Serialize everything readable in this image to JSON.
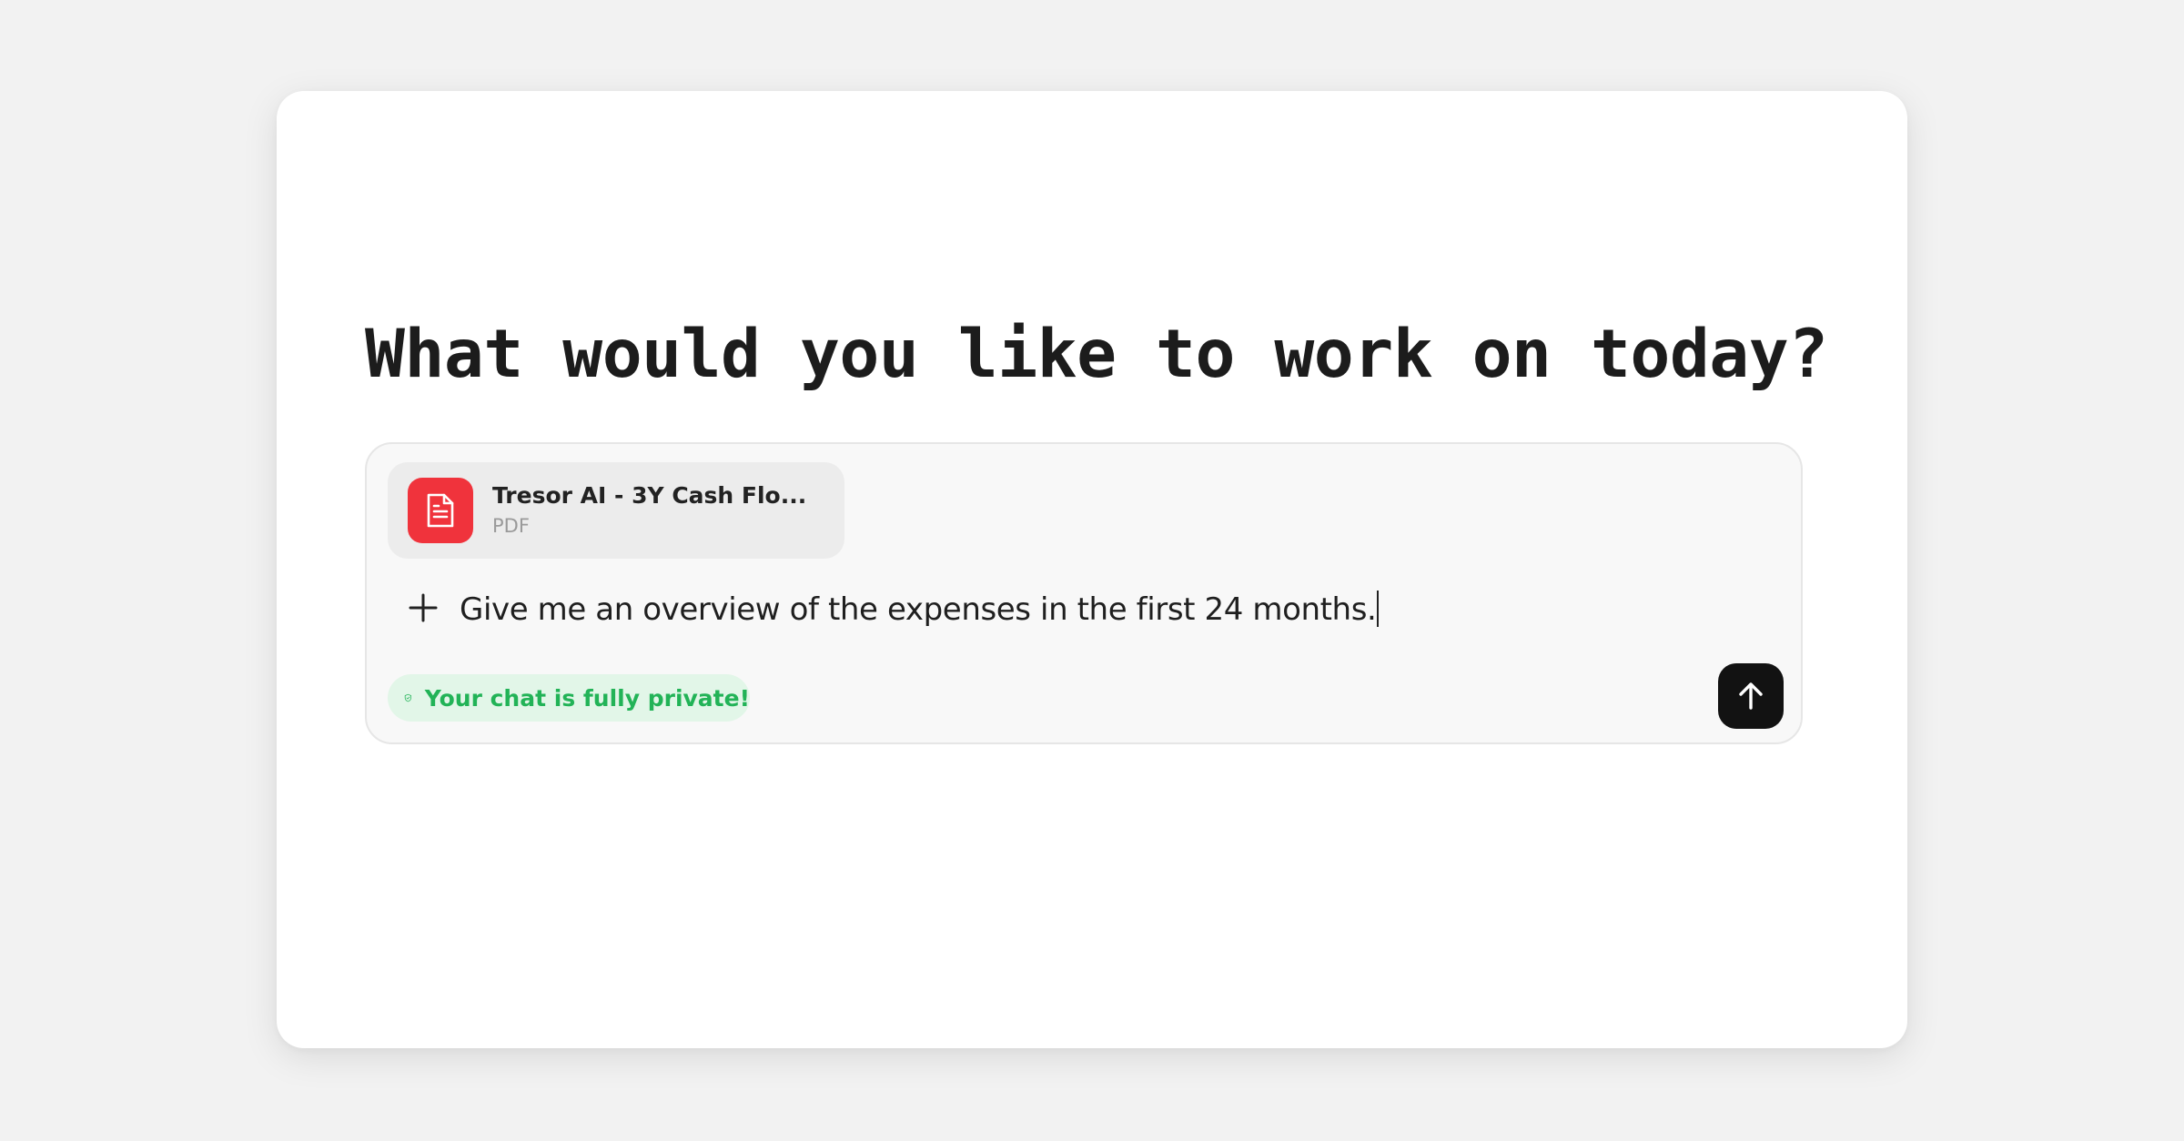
{
  "main": {
    "heading": "What would you like to work on today?"
  },
  "composer": {
    "attachment": {
      "name": "Tresor AI - 3Y Cash Flo...",
      "type": "PDF",
      "icon": "document-icon",
      "icon_bg": "#f0333c"
    },
    "add_icon": "plus-icon",
    "input_value": "Give me an overview of the expenses in the first 24 months.",
    "privacy": {
      "label": "Your chat is fully private!",
      "icon": "shield-check-icon",
      "color": "#22b357"
    },
    "send_icon": "arrow-up-icon"
  }
}
